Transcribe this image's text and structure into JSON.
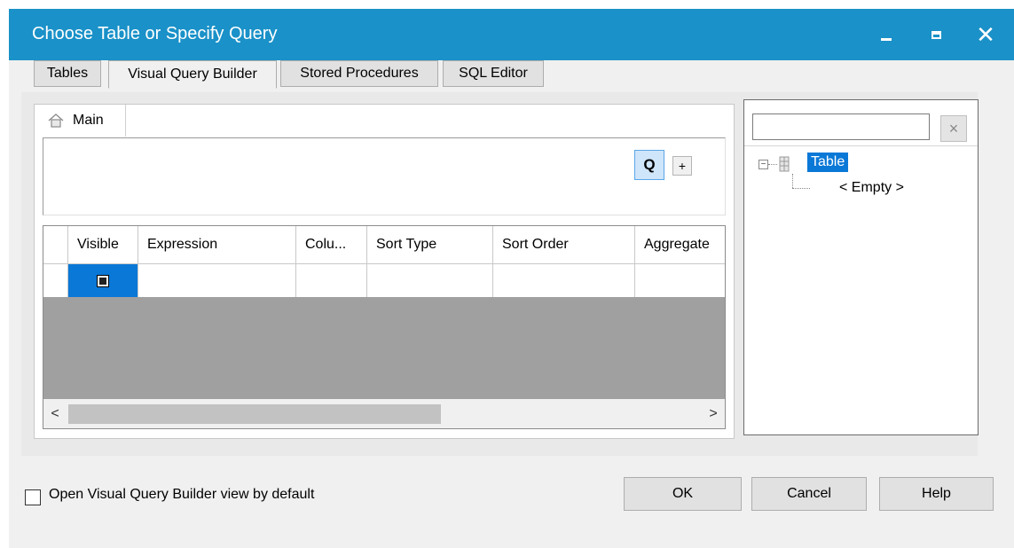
{
  "window": {
    "title": "Choose Table or Specify Query"
  },
  "tabs": [
    {
      "label": "Tables"
    },
    {
      "label": "Visual Query Builder"
    },
    {
      "label": "Stored Procedures"
    },
    {
      "label": "SQL Editor"
    }
  ],
  "builder": {
    "main_tab": "Main",
    "query_button": "Q",
    "add_button": "+",
    "columns": [
      "Visible",
      "Expression",
      "Colu...",
      "Sort Type",
      "Sort Order",
      "Aggregate"
    ],
    "scroll_left": "<",
    "scroll_right": ">"
  },
  "tree": {
    "search_value": "",
    "clear_label": "×",
    "expander": "−",
    "root": "Table",
    "child": "< Empty >"
  },
  "footer": {
    "default_view_label": "Open Visual Query Builder view by default",
    "ok": "OK",
    "cancel": "Cancel",
    "help": "Help"
  },
  "colors": {
    "titlebar": "#1a91c8",
    "selection": "#0a78d7"
  }
}
